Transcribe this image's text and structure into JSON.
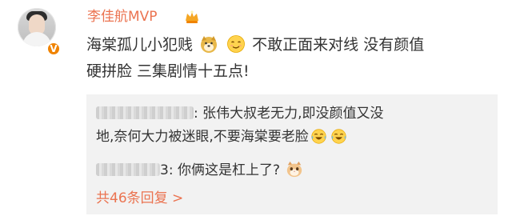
{
  "user": {
    "name": "李佳航MVP",
    "verified_badge": "V",
    "avatar_icon": "user-avatar",
    "crown_icon": "vip-crown-icon"
  },
  "post": {
    "line1_a": "海棠孤儿小犯贱",
    "line1_b": "不敢正面来对线 没有颜值",
    "line2": "硬拼脸 三集剧情十五点!",
    "emoji_1": "doge-emoji",
    "emoji_2": "smirk-emoji"
  },
  "replies": [
    {
      "author_suffix": ":",
      "line1": "张伟大叔老无力,即没颜值又没",
      "line2": "地,奈何大力被迷眼,不要海棠要老脸",
      "emoji": "laugh-cry-emoji"
    },
    {
      "author_suffix": "3:",
      "text": "你俩这是杠上了?",
      "emoji": "cat-emoji"
    }
  ],
  "more_replies": "共46条回复 >",
  "colors": {
    "accent": "#eb7350",
    "badge": "#f08300",
    "reply_bg": "#f2f2f2",
    "text": "#333333"
  }
}
